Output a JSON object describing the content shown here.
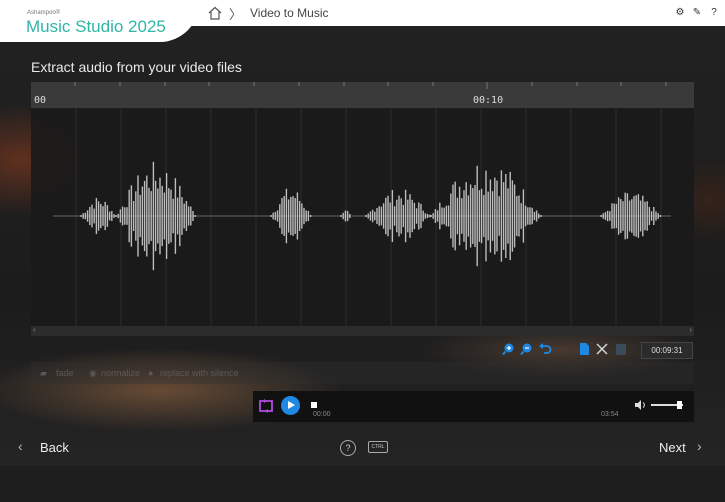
{
  "app": {
    "vendor": "Ashampoo®",
    "name": "Music Studio 2025",
    "breadcrumb": "Video to Music",
    "accent": "#2fb6a7"
  },
  "header_icons": [
    "home-icon",
    "gear-icon",
    "edit-icon",
    "help-icon"
  ],
  "help_glyph": "?",
  "page": {
    "title": "Extract audio from your video files"
  },
  "editor": {
    "ruler_labels": [
      "00",
      "00:10"
    ],
    "selection_time": "00:09:31",
    "tools": [
      "zoom-in-icon",
      "zoom-out-icon",
      "undo-icon",
      "new-file-icon",
      "cut-icon",
      "paste-icon"
    ],
    "effects": [
      "fade",
      "normalize",
      "replace with silence"
    ]
  },
  "player": {
    "current_time": "00:00",
    "total_time": "03:54",
    "volume": 0.9
  },
  "footer": {
    "back_label": "Back",
    "next_label": "Next",
    "shortcut_label": "CTRL"
  }
}
